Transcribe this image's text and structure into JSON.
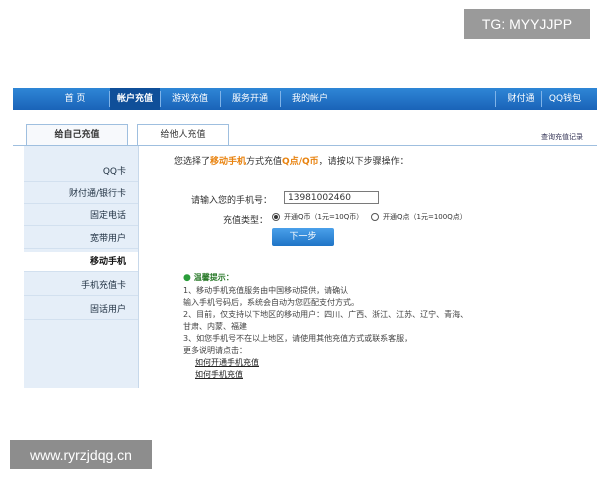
{
  "watermarks": {
    "top_right": "TG: MYYJJPP",
    "bottom_left": "www.ryrzjdqg.cn"
  },
  "nav": {
    "items": [
      "首 页",
      "帐户充值",
      "游戏充值",
      "服务开通",
      "我的帐户"
    ],
    "right_items": [
      "财付通",
      "QQ钱包"
    ]
  },
  "tabs": {
    "self": "给自己充值",
    "other": "给他人充值",
    "right_link": "查询充值记录"
  },
  "sidebar": {
    "items": [
      "QQ卡",
      "财付通/银行卡",
      "固定电话",
      "宽带用户",
      "移动手机",
      "手机充值卡",
      "固话用户"
    ]
  },
  "content": {
    "intro_prefix": "您选择了",
    "method": "移动手机",
    "intro_mid": "方式充值",
    "product": "Q点/Q币",
    "intro_suffix": "，请按以下步骤操作：",
    "phone_label": "请输入您的手机号：",
    "phone_value": "13981002460",
    "type_label": "充值类型：",
    "option1": "开通Q币（1元=10Q币）",
    "option2": "开通Q点（1元=100Q点）",
    "next_button": "下一步",
    "tips_title": "温馨提示：",
    "tips": [
      "1、移动手机充值服务由中国移动提供，请确认",
      "   输入手机号码后，系统会自动为您匹配支付方式。",
      "2、目前，仅支持以下地区的移动用户：四川、广西、浙江、江苏、辽宁、青海、",
      "   甘肃、内蒙、福建",
      "3、如您手机号不在以上地区，请使用其他充值方式或联系客服，",
      "   更多说明请点击："
    ],
    "links": [
      "如何开通手机充值",
      "如何手机充值"
    ]
  }
}
